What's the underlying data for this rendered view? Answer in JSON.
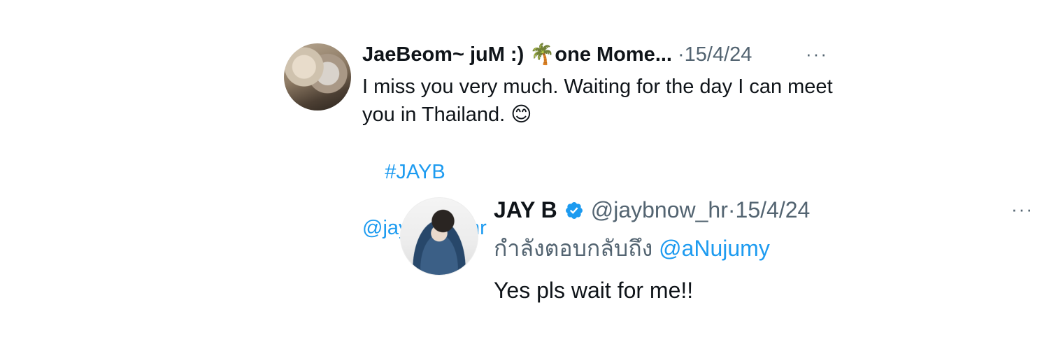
{
  "original_tweet": {
    "display_name": "JaeBeom~ juM :) 🌴one Mome...",
    "separator": "·",
    "date": "15/4/24",
    "more_icon": "···",
    "text": "I miss you very much. Waiting for the day I can meet you in Thailand. 😊",
    "hashtag": "#JAYB",
    "mention": "@jaybnow_hr"
  },
  "reply_tweet": {
    "display_name": "JAY B",
    "handle": "@jaybnow_hr",
    "separator": "·",
    "date": "15/4/24",
    "more_icon": "···",
    "replying_to_label": "กำลังตอบกลับถึง",
    "replying_to_handle": "@aNujumy",
    "text": "Yes pls wait for me!!"
  },
  "colors": {
    "link": "#1d9bf0",
    "muted": "#536471",
    "text": "#0f1419",
    "verified": "#1d9bf0"
  }
}
